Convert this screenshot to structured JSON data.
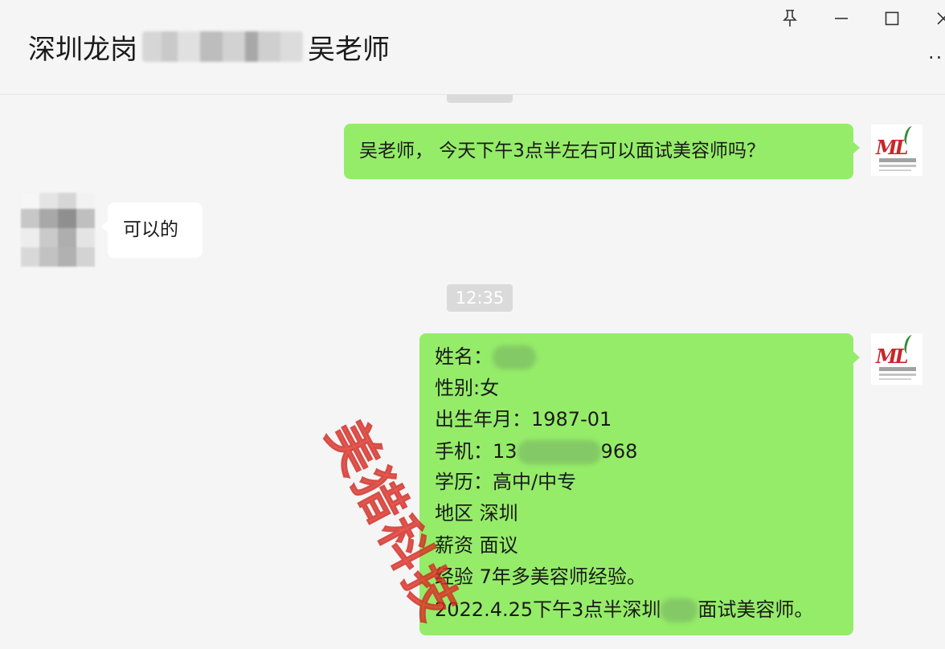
{
  "window": {
    "title_prefix": "深圳龙岗",
    "title_suffix": "吴老师",
    "controls": {
      "pin": "pin-icon",
      "minimize": "minimize-icon",
      "maximize": "maximize-icon",
      "close": "close-icon",
      "more": "more-icon"
    }
  },
  "messages": [
    {
      "side": "right",
      "text": "吴老师， 今天下午3点半左右可以面试美容师吗？"
    },
    {
      "side": "left",
      "text": "可以的"
    }
  ],
  "timestamp": "12:35",
  "resume": {
    "name_label": "姓名：",
    "gender": "性别:女",
    "birth": "出生年月：1987-01",
    "phone_prefix": "手机：13",
    "phone_suffix": "968",
    "education": "学历：高中/中专",
    "region": "地区 深圳",
    "salary": "薪资  面议",
    "experience": "经验 7年多美容师经验。",
    "interview_prefix": "2022.4.25下午3点半深圳",
    "interview_suffix": "面试美容师。"
  },
  "avatar_logo_text": "ML",
  "watermark": "美猎科技",
  "colors": {
    "sent_bubble": "#95ec69",
    "received_bubble": "#ffffff",
    "background": "#f5f5f5",
    "watermark": "#e8362d"
  }
}
